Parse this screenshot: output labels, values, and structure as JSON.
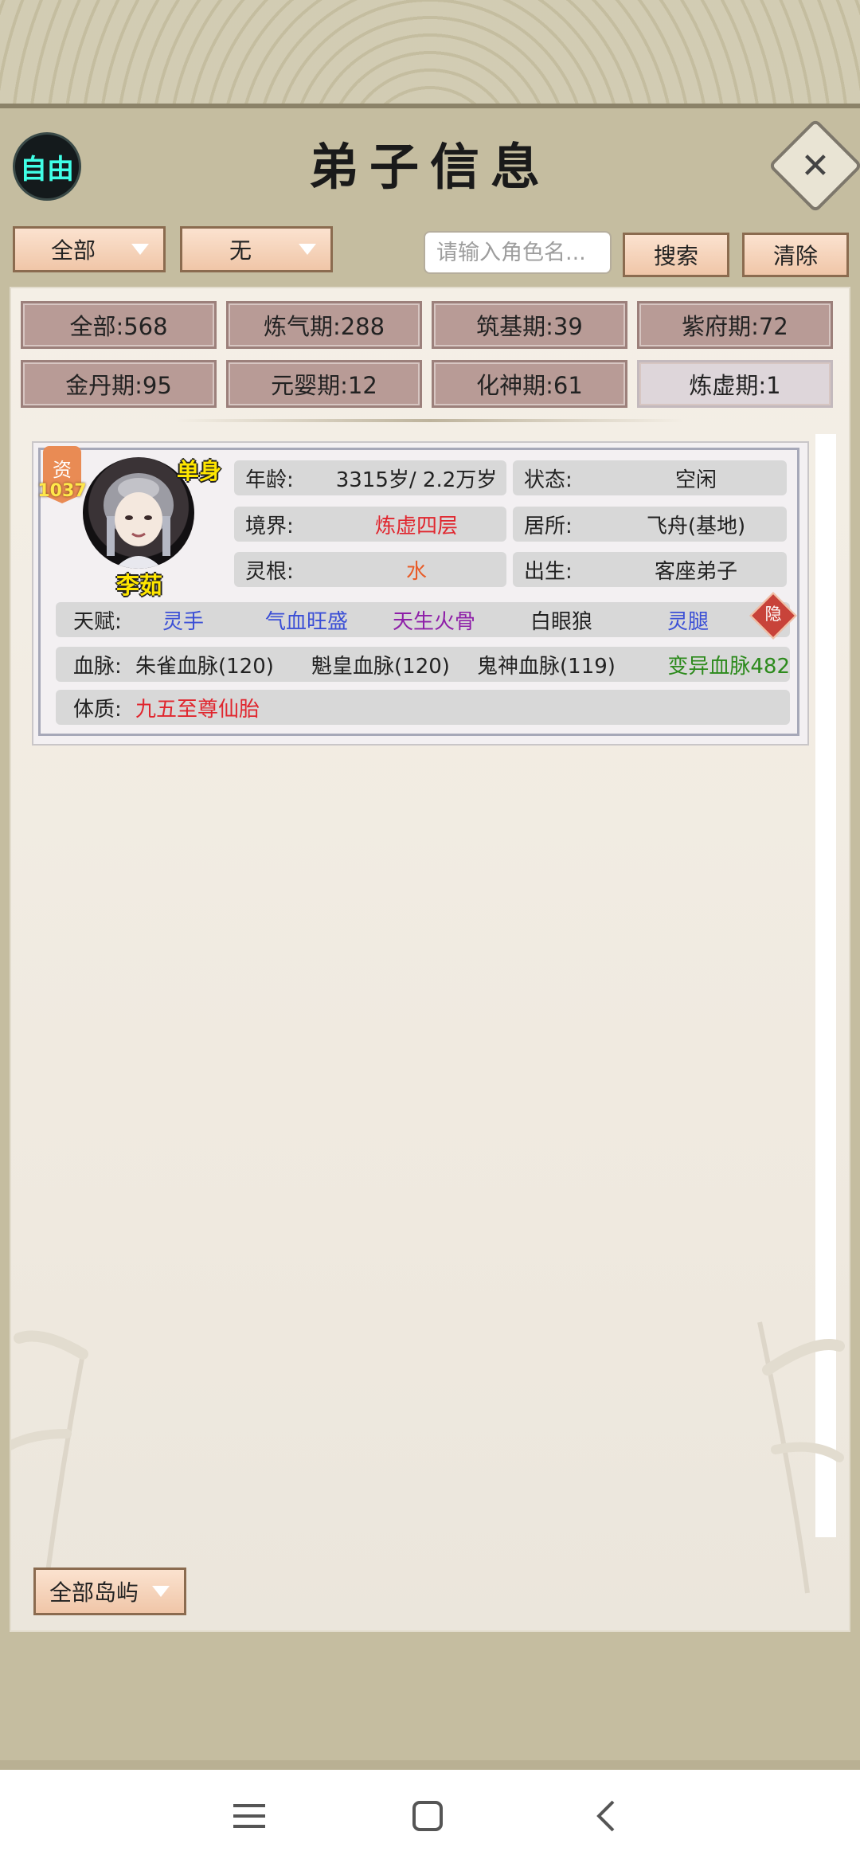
{
  "header": {
    "mode_label": "自由",
    "title": "弟子信息"
  },
  "filters": {
    "category": "全部",
    "sub": "无",
    "search_placeholder": "请输入角色名...",
    "search_label": "搜索",
    "clear_label": "清除"
  },
  "tabs": [
    {
      "label": "全部:568"
    },
    {
      "label": "炼气期:288"
    },
    {
      "label": "筑基期:39"
    },
    {
      "label": "紫府期:72"
    },
    {
      "label": "金丹期:95"
    },
    {
      "label": "元婴期:12"
    },
    {
      "label": "化神期:61"
    },
    {
      "label": "炼虚期:1"
    }
  ],
  "character": {
    "aptitude_label": "资",
    "aptitude_value": "1037",
    "single_tag": "单身",
    "name": "李茹",
    "fields": {
      "age_label": "年龄:",
      "age_value": "3315岁/ 2.2万岁",
      "status_label": "状态:",
      "status_value": "空闲",
      "realm_label": "境界:",
      "realm_value": "炼虚四层",
      "residence_label": "居所:",
      "residence_value": "飞舟(基地)",
      "root_label": "灵根:",
      "root_value": "水",
      "origin_label": "出生:",
      "origin_value": "客座弟子"
    },
    "talent_label": "天赋:",
    "talents": [
      "灵手",
      "气血旺盛",
      "天生火骨",
      "白眼狼",
      "灵腿"
    ],
    "hidden_badge": "隐",
    "bloodline_label": "血脉:",
    "bloodlines": [
      "朱雀血脉(120)",
      "魁皇血脉(120)",
      "鬼神血脉(119)",
      "变异血脉482"
    ],
    "physique_label": "体质:",
    "physique_value": "九五至尊仙胎"
  },
  "island_filter": "全部岛屿",
  "navbar": {
    "menu_icon": "menu-icon",
    "home_icon": "home-icon",
    "back_icon": "back-icon"
  },
  "colors": {
    "realm": "#e0262e",
    "root": "#e85c28",
    "talent_blue": "#3b4fd6",
    "talent_purple": "#8e1fa8",
    "bloodline_green": "#2c8a1c",
    "physique": "#e0262e"
  }
}
